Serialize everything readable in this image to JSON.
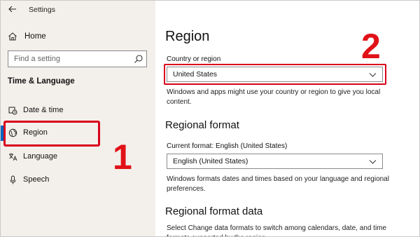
{
  "window": {
    "title": "Settings"
  },
  "sidebar": {
    "home_label": "Home",
    "search_placeholder": "Find a setting",
    "section_title": "Time & Language",
    "items": [
      {
        "label": "Date & time",
        "icon": "calendar-clock-icon"
      },
      {
        "label": "Region",
        "icon": "globe-icon",
        "selected": true
      },
      {
        "label": "Language",
        "icon": "language-icon"
      },
      {
        "label": "Speech",
        "icon": "microphone-icon"
      }
    ]
  },
  "main": {
    "title": "Region",
    "country": {
      "label": "Country or region",
      "value": "United States",
      "description": "Windows and apps might use your country or region to give you local content."
    },
    "regional_format": {
      "heading": "Regional format",
      "current_label": "Current format: English (United States)",
      "value": "English (United States)",
      "description": "Windows formats dates and times based on your language and regional preferences."
    },
    "regional_format_data": {
      "heading": "Regional format data",
      "description": "Select Change data formats to switch among calendars, date, and time formats supported by the region."
    }
  },
  "annotations": {
    "step1": "1",
    "step2": "2",
    "highlight_color": "#d9001b",
    "number_color": "#e01218"
  },
  "colors": {
    "sidebar_bg": "#f3efea",
    "accent": "#0067c0"
  }
}
